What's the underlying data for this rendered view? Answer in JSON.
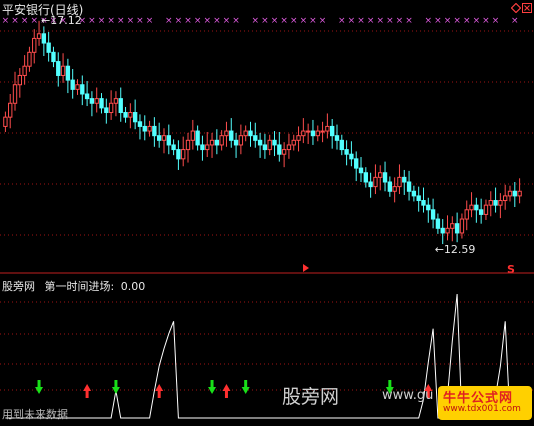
{
  "window": {
    "title": "平安银行(日线)",
    "icons": [
      "diamond-icon",
      "close-icon"
    ]
  },
  "colors": {
    "background": "#000000",
    "up_candle": "#ff4d4d",
    "down_candle": "#53ffff",
    "grid": "#a01515",
    "panel_divider": "#c02020",
    "title_text": "#e8e8e8",
    "magenta_marks": "#e05ce0",
    "indicator_line": "#ffffff",
    "up_arrow": "#ff3030",
    "down_arrow": "#19e019",
    "watermark": "#d0d0d0",
    "logo_red": "#e02020",
    "logo_yellow": "#ffd000"
  },
  "price_panel": {
    "high_label": "17.12",
    "low_label": "12.59"
  },
  "indicator_panel": {
    "name_label": "股旁网",
    "indicator_name": "第一时间进场:",
    "indicator_value": "0.00",
    "footer_text": "用到未来数据"
  },
  "watermark": {
    "text": "股旁网",
    "url_fragment": "www.gu"
  },
  "logo": {
    "title": "牛牛公式网",
    "url": "www.tdx001.com"
  },
  "chart_data": [
    {
      "type": "candlestick",
      "title": "平安银行(日线)",
      "ylim": [
        11.9,
        17.6
      ],
      "grid": true,
      "annotations": [
        {
          "text": "17.12",
          "kind": "period-high"
        },
        {
          "text": "12.59",
          "kind": "period-low"
        }
      ],
      "close_series": [
        15.2,
        15.5,
        15.9,
        16.1,
        16.3,
        16.6,
        16.9,
        17.0,
        16.8,
        16.6,
        16.4,
        16.1,
        16.3,
        16.0,
        15.8,
        15.9,
        15.7,
        15.6,
        15.5,
        15.6,
        15.4,
        15.3,
        15.5,
        15.6,
        15.3,
        15.2,
        15.3,
        15.1,
        15.0,
        14.9,
        15.0,
        14.8,
        14.7,
        14.8,
        14.6,
        14.5,
        14.3,
        14.5,
        14.7,
        14.9,
        14.6,
        14.5,
        14.6,
        14.7,
        14.6,
        14.8,
        14.9,
        14.7,
        14.6,
        14.8,
        14.9,
        14.8,
        14.7,
        14.6,
        14.5,
        14.7,
        14.6,
        14.4,
        14.5,
        14.6,
        14.7,
        14.8,
        14.9,
        14.9,
        14.8,
        14.9,
        14.9,
        15.0,
        14.8,
        14.7,
        14.5,
        14.4,
        14.3,
        14.1,
        14.0,
        13.8,
        13.7,
        13.9,
        14.0,
        13.8,
        13.6,
        13.7,
        13.9,
        13.8,
        13.6,
        13.5,
        13.4,
        13.3,
        13.2,
        13.0,
        12.8,
        12.7,
        12.8,
        12.9,
        12.7,
        13.0,
        13.2,
        13.3,
        13.2,
        13.1,
        13.3,
        13.4,
        13.3,
        13.4,
        13.5,
        13.6,
        13.5,
        13.6
      ]
    },
    {
      "type": "line",
      "title": "第一时间进场: 0.00",
      "series": [
        {
          "name": "第一时间进场",
          "values": [
            0.0,
            0.0,
            0.0,
            0.0,
            0.0,
            0.0,
            0.0,
            0.0,
            0.0,
            0.0,
            0.0,
            0.0,
            0.0,
            0.0,
            0.0,
            0.0,
            0.0,
            0.0,
            0.0,
            0.0,
            0.0,
            0.0,
            0.0,
            0.22,
            0.0,
            0.0,
            0.0,
            0.0,
            0.0,
            0.0,
            0.0,
            0.22,
            0.42,
            0.56,
            0.68,
            0.78,
            0.0,
            0.0,
            0.0,
            0.0,
            0.0,
            0.0,
            0.0,
            0.0,
            0.0,
            0.0,
            0.0,
            0.0,
            0.0,
            0.0,
            0.0,
            0.0,
            0.0,
            0.0,
            0.0,
            0.0,
            0.0,
            0.0,
            0.0,
            0.0,
            0.0,
            0.0,
            0.0,
            0.0,
            0.0,
            0.0,
            0.0,
            0.0,
            0.0,
            0.0,
            0.0,
            0.0,
            0.0,
            0.0,
            0.0,
            0.0,
            0.0,
            0.0,
            0.0,
            0.0,
            0.0,
            0.0,
            0.0,
            0.0,
            0.0,
            0.0,
            0.0,
            0.15,
            0.45,
            0.72,
            0.0,
            0.0,
            0.18,
            0.62,
            1.0,
            0.0,
            0.0,
            0.0,
            0.0,
            0.0,
            0.0,
            0.0,
            0.18,
            0.42,
            0.78,
            0.0,
            0.0,
            0.0
          ]
        }
      ],
      "signals": {
        "down_arrows_at": [
          7,
          23,
          43,
          50,
          80
        ],
        "up_arrows_at": [
          17,
          32,
          46,
          88
        ]
      }
    }
  ]
}
